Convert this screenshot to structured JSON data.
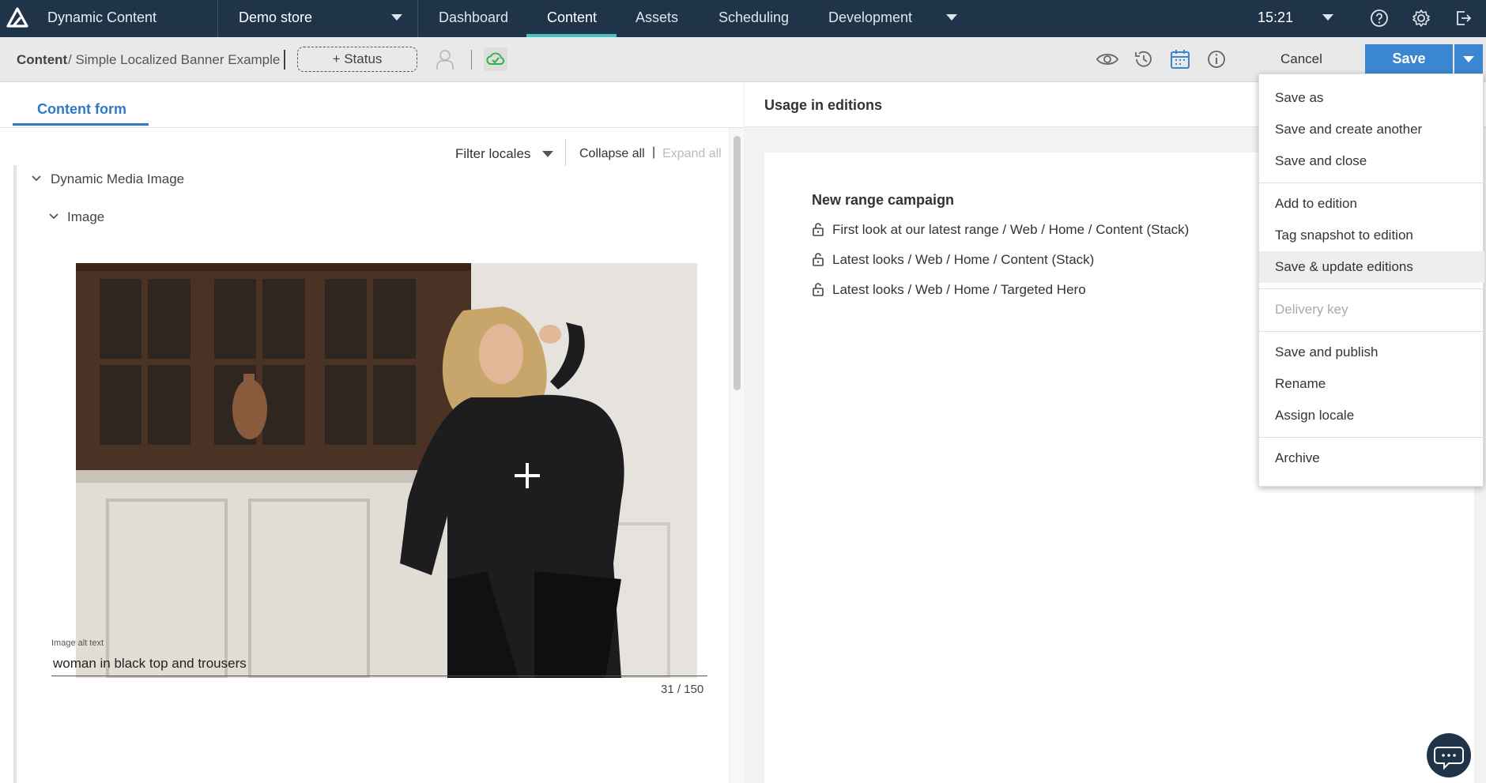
{
  "app": {
    "name": "Dynamic Content",
    "store": "Demo store",
    "nav": [
      "Dashboard",
      "Content",
      "Assets",
      "Scheduling",
      "Development"
    ],
    "active_nav": "Content",
    "clock": "15:21"
  },
  "toolbar": {
    "breadcrumb_root": "Content",
    "breadcrumb_rest": "/ Simple Localized Banner Example",
    "status_label": "+ Status",
    "cancel_label": "Cancel",
    "save_label": "Save"
  },
  "form": {
    "tab_label": "Content form",
    "filter_locales": "Filter locales",
    "collapse_all": "Collapse all",
    "bar_separator": "|",
    "expand_all": "Expand all",
    "tree": {
      "root": "Dynamic Media Image",
      "child": "Image"
    },
    "alt_text": {
      "label": "Image alt text",
      "value": "woman in black top and trousers",
      "count": "31 / 150"
    }
  },
  "usage": {
    "title": "Usage in editions",
    "edition": "New range campaign",
    "rows": [
      "First look at our latest range  /  Web / Home / Content (Stack)",
      "Latest looks  /  Web / Home / Content (Stack)",
      "Latest looks  /  Web / Home / Targeted Hero"
    ]
  },
  "menu": {
    "items": [
      "Save as",
      "Save and create another",
      "Save and close",
      "Add to edition",
      "Tag snapshot to edition",
      "Save & update editions",
      "Delivery key",
      "Save and publish",
      "Rename",
      "Assign locale",
      "Archive"
    ],
    "highlighted": "Save & update editions",
    "disabled": "Delivery key"
  },
  "colors": {
    "topbar": "#1f3448",
    "accent": "#3a86d0",
    "nav_underline": "#44c2c6",
    "sync_green": "#2fb34a"
  }
}
